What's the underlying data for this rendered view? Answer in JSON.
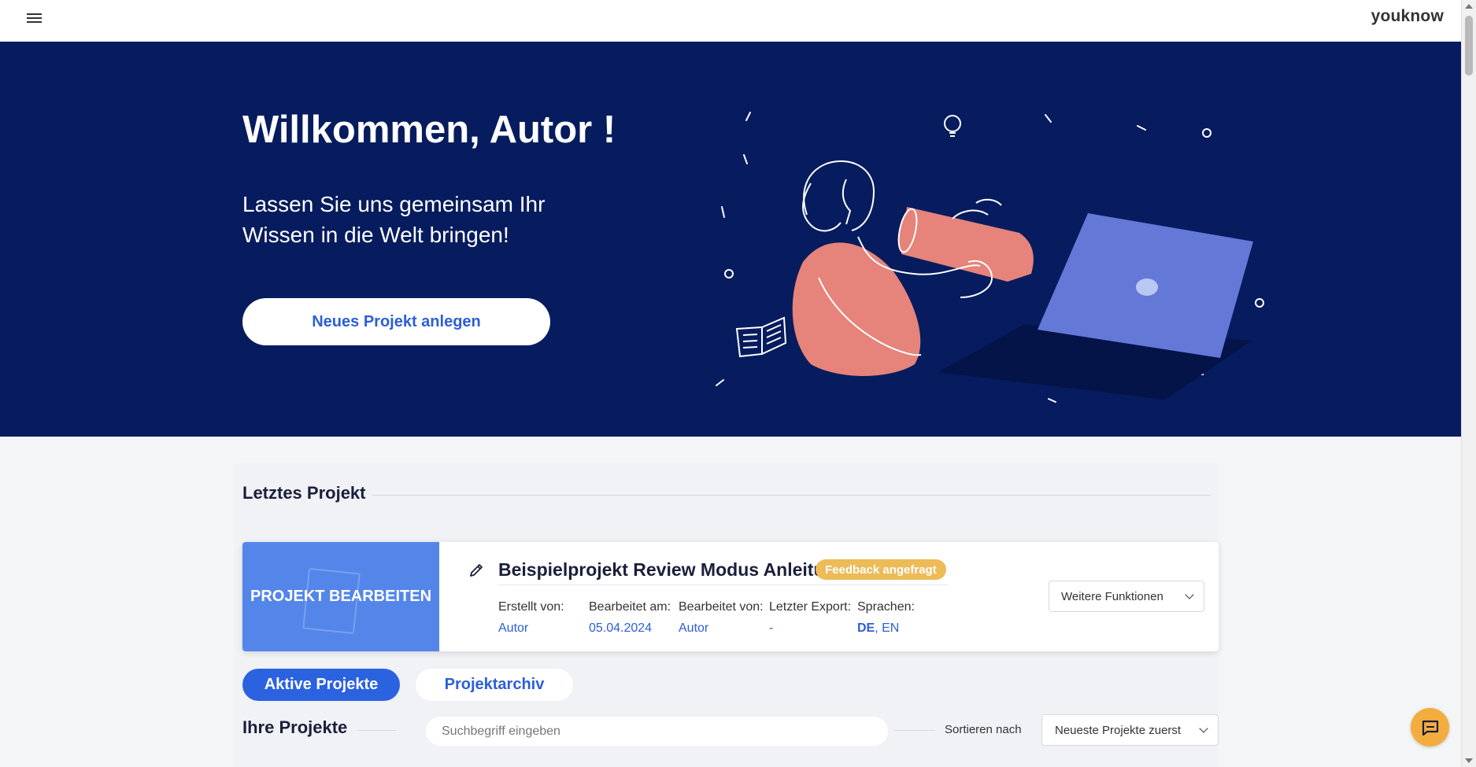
{
  "header": {
    "brand": "youknow",
    "menu_icon": "hamburger-menu-icon"
  },
  "hero": {
    "title": "Willkommen, Autor !",
    "subtitle": "Lassen Sie uns gemeinsam Ihr Wissen in die Welt bringen!",
    "cta_label": "Neues Projekt anlegen",
    "background_color": "#061c5e"
  },
  "last_project": {
    "section_title": "Letztes Projekt",
    "thumb_label": "PROJEKT BEARBEITEN",
    "title": "Beispielprojekt Review Modus Anleitu...",
    "status_badge": "Feedback angefragt",
    "meta": {
      "created_by_label": "Erstellt von:",
      "created_by": "Autor",
      "edited_on_label": "Bearbeitet am:",
      "edited_on": "05.04.2024",
      "edited_by_label": "Bearbeitet von:",
      "edited_by": "Autor",
      "last_export_label": "Letzter Export:",
      "last_export": "-",
      "languages_label": "Sprachen:",
      "language_primary": "DE",
      "language_secondary": ", EN"
    },
    "more_label": "Weitere Funktionen"
  },
  "tabs": {
    "active": "Aktive Projekte",
    "archive": "Projektarchiv"
  },
  "projects": {
    "section_title": "Ihre Projekte",
    "search_placeholder": "Suchbegriff eingeben",
    "sort_label": "Sortieren nach",
    "sort_value": "Neueste Projekte zuerst"
  },
  "colors": {
    "accent": "#2b62e0",
    "thumb": "#5486ea",
    "badge": "#edbb58",
    "chat": "#f3ad3f"
  }
}
